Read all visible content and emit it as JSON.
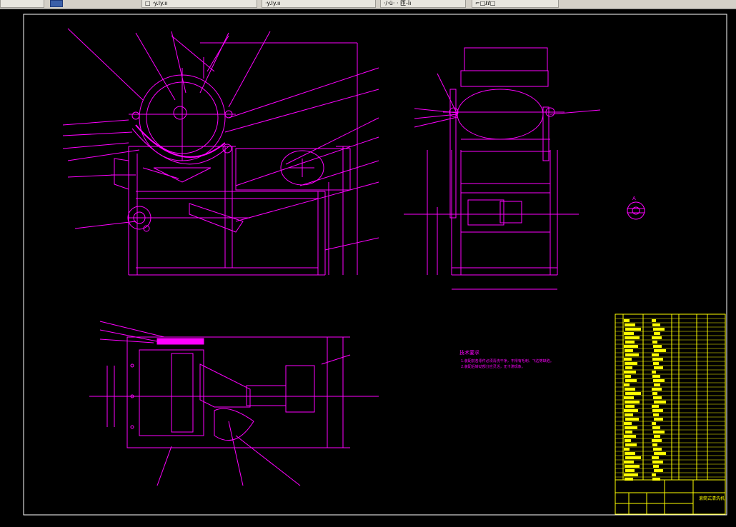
{
  "toolbar": {
    "tabs": [
      {
        "label": "□ ·y.ly.ıı"
      },
      {
        "label": "·y.ly.ıı"
      },
      {
        "label": "·/·ü· · 匝-ǐı"
      },
      {
        "label": "⌐□ℓℓ□"
      }
    ]
  },
  "drawing": {
    "notes_title": "技术要求",
    "notes_lines": [
      "1.装配前各零件必须清洗干净，不得有毛刺、飞边等缺陷。",
      "2.装配后转动部分应灵活，无卡滞现象。"
    ],
    "title_block_name": "滚筒式清洗机",
    "detail_label": "A"
  },
  "colors": {
    "background": "#000000",
    "line": "#ff00ff",
    "frame": "#ffffff",
    "table": "#ffff00"
  }
}
